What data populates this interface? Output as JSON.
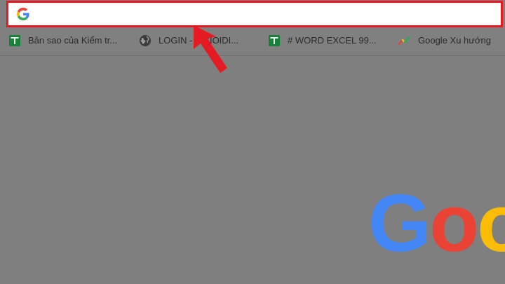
{
  "omnibox": {
    "value": "",
    "placeholder": "",
    "icon": "google-g-icon"
  },
  "highlight_color": "#e51b24",
  "bookmarks": [
    {
      "label": "Bản sao của Kiểm tr...",
      "icon": "google-sheets-icon",
      "color": "#188038"
    },
    {
      "label": "LOGIN - ...GIOIDI...",
      "icon": "globe-icon",
      "color": "#3c3c3c"
    },
    {
      "label": "# WORD EXCEL 99...",
      "icon": "google-sheets-icon",
      "color": "#188038"
    },
    {
      "label": "Google Xu hướng",
      "icon": "google-trends-icon",
      "color": "#4285f4"
    }
  ],
  "logo": {
    "letters": [
      "G",
      "o",
      "o"
    ],
    "colors": [
      "#4285f4",
      "#ea4335",
      "#fbbc05"
    ]
  },
  "annotation": {
    "icon": "red-arrow-icon",
    "color": "#e51b24"
  }
}
